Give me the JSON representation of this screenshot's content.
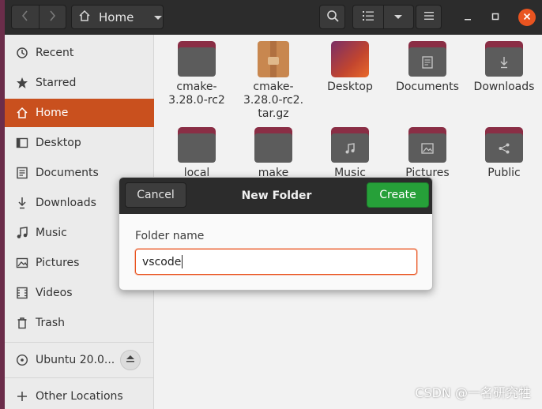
{
  "header": {
    "path_label": "Home"
  },
  "sidebar": {
    "items": [
      {
        "label": "Recent",
        "icon": "clock-icon"
      },
      {
        "label": "Starred",
        "icon": "star-icon"
      },
      {
        "label": "Home",
        "icon": "home-icon",
        "active": true
      },
      {
        "label": "Desktop",
        "icon": "desktop-icon"
      },
      {
        "label": "Documents",
        "icon": "documents-icon"
      },
      {
        "label": "Downloads",
        "icon": "download-icon"
      },
      {
        "label": "Music",
        "icon": "music-icon"
      },
      {
        "label": "Pictures",
        "icon": "pictures-icon"
      },
      {
        "label": "Videos",
        "icon": "videos-icon"
      },
      {
        "label": "Trash",
        "icon": "trash-icon"
      }
    ],
    "device": {
      "label": "Ubuntu 20.0...",
      "icon": "disc-icon"
    },
    "other_locations": "Other Locations"
  },
  "files": [
    {
      "name": "cmake-3.28.0-rc2",
      "kind": "folder"
    },
    {
      "name": "cmake-3.28.0-rc2.tar.gz",
      "kind": "archive"
    },
    {
      "name": "Desktop",
      "kind": "desktop"
    },
    {
      "name": "Documents",
      "kind": "folder-documents"
    },
    {
      "name": "Downloads",
      "kind": "folder-downloads"
    },
    {
      "name": "local",
      "kind": "folder"
    },
    {
      "name": "make",
      "kind": "folder"
    },
    {
      "name": "Music",
      "kind": "folder-music"
    },
    {
      "name": "Pictures",
      "kind": "folder-pictures"
    },
    {
      "name": "Public",
      "kind": "folder-public"
    }
  ],
  "file_labels": {
    "f0": "cmake-\n3.28.0-rc2",
    "f1": "cmake-\n3.28.0-rc2.\ntar.gz",
    "f2": "Desktop",
    "f3": "Documents",
    "f4": "Downloads",
    "f5": "local",
    "f6": "make",
    "f7": "Music",
    "f8": "Pictures",
    "f9": "Public"
  },
  "dialog": {
    "title": "New Folder",
    "cancel_label": "Cancel",
    "create_label": "Create",
    "field_label": "Folder name",
    "field_value": "vscode"
  },
  "colors": {
    "accent": "#e95420",
    "create_button": "#26a039",
    "headerbar": "#2c2c2c"
  },
  "watermark": "CSDN @一名研究牲"
}
